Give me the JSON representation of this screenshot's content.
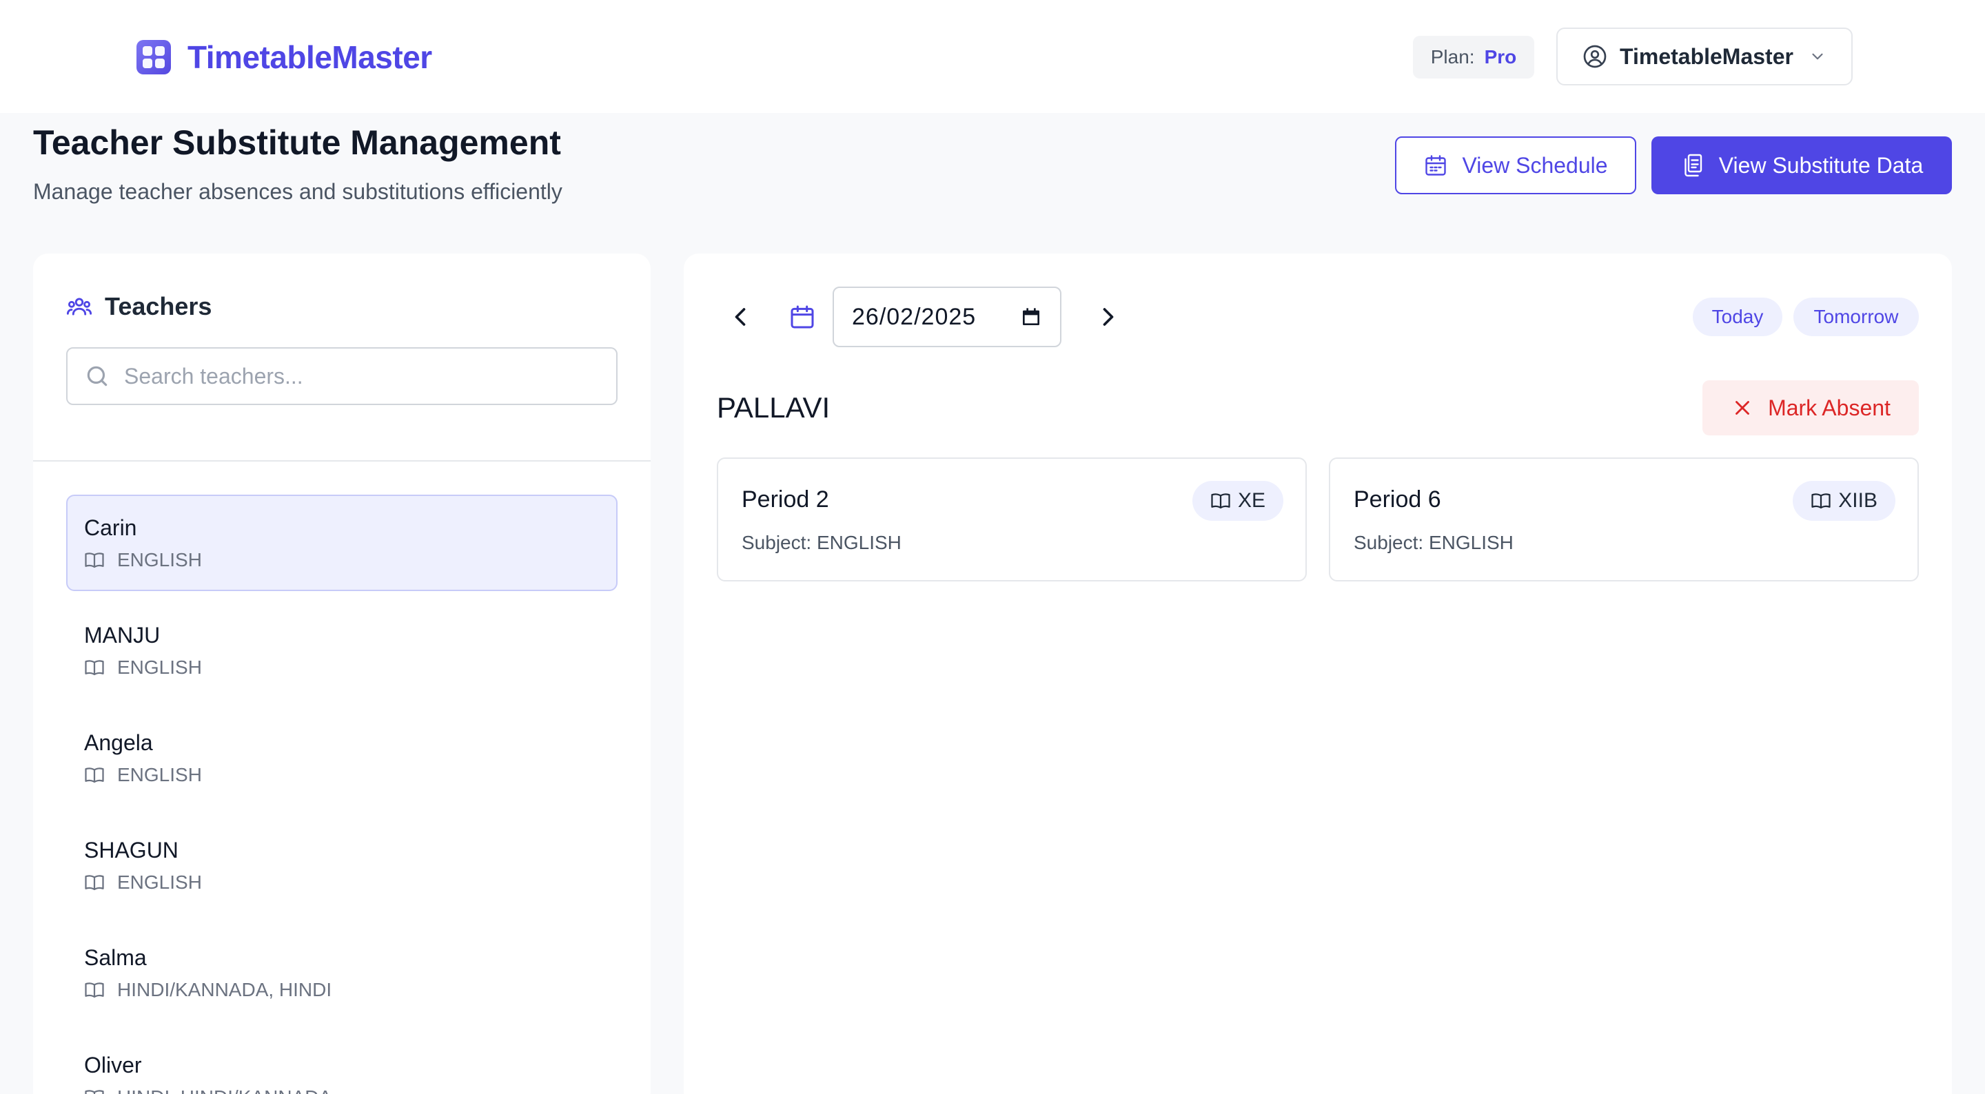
{
  "app": {
    "name": "TimetableMaster",
    "logo_icon": "app-grid-icon",
    "brand_color": "#4f46e5"
  },
  "plan": {
    "label": "Plan:",
    "value": "Pro"
  },
  "user_menu": {
    "name": "TimetableMaster",
    "icon": "user-circle-icon",
    "caret": "chevron-down-icon"
  },
  "header": {
    "title": "Teacher Substitute Management",
    "subtitle": "Manage teacher absences and substitutions efficiently",
    "view_schedule_label": "View Schedule",
    "view_substitute_label": "View Substitute Data"
  },
  "teachers_panel": {
    "title": "Teachers",
    "search_placeholder": "Search teachers...",
    "search_value": "",
    "items": [
      {
        "name": "Carin",
        "subject": "ENGLISH",
        "selected": true
      },
      {
        "name": "MANJU",
        "subject": "ENGLISH",
        "selected": false
      },
      {
        "name": "Angela",
        "subject": "ENGLISH",
        "selected": false
      },
      {
        "name": "SHAGUN",
        "subject": "ENGLISH",
        "selected": false
      },
      {
        "name": "Salma",
        "subject": "HINDI/KANNADA, HINDI",
        "selected": false
      },
      {
        "name": "Oliver",
        "subject": "HINDI, HINDI/KANNADA",
        "selected": false
      }
    ]
  },
  "schedule": {
    "date": "26/02/2025",
    "quick_today": "Today",
    "quick_tomorrow": "Tomorrow",
    "teacher_name": "PALLAVI",
    "mark_absent_label": "Mark Absent",
    "subject_prefix": "Subject:",
    "periods": [
      {
        "title": "Period 2",
        "class": "XE",
        "subject": "ENGLISH"
      },
      {
        "title": "Period 6",
        "class": "XIIB",
        "subject": "ENGLISH"
      }
    ]
  }
}
